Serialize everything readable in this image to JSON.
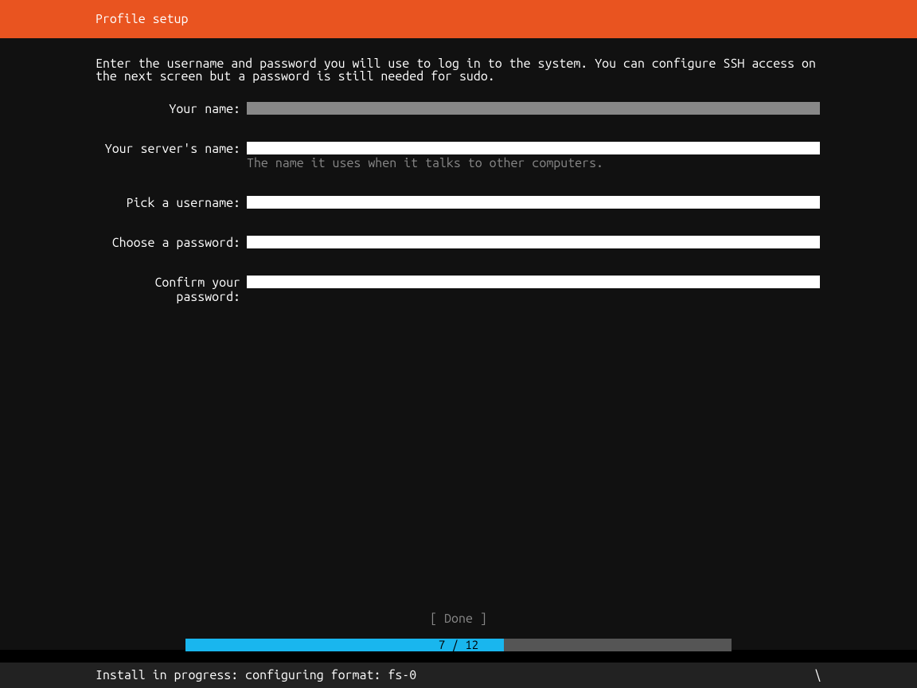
{
  "header": {
    "title": "Profile setup"
  },
  "description": "Enter the username and password you will use to log in to the system. You can configure SSH access on the next screen but a password is still needed for sudo.",
  "form": {
    "name": {
      "label": "Your name:",
      "value": ""
    },
    "server_name": {
      "label": "Your server's name:",
      "value": "",
      "hint": "The name it uses when it talks to other computers."
    },
    "username": {
      "label": "Pick a username:",
      "value": ""
    },
    "password": {
      "label": "Choose a password:",
      "value": ""
    },
    "confirm_password": {
      "label": "Confirm your password:",
      "value": ""
    }
  },
  "footer": {
    "done_label": "[ Done       ]",
    "progress": {
      "current": 7,
      "total": 12,
      "text": "7 / 12",
      "percent": 58.3
    },
    "status": "Install in progress: configuring format: fs-0",
    "spinner": "\\"
  }
}
